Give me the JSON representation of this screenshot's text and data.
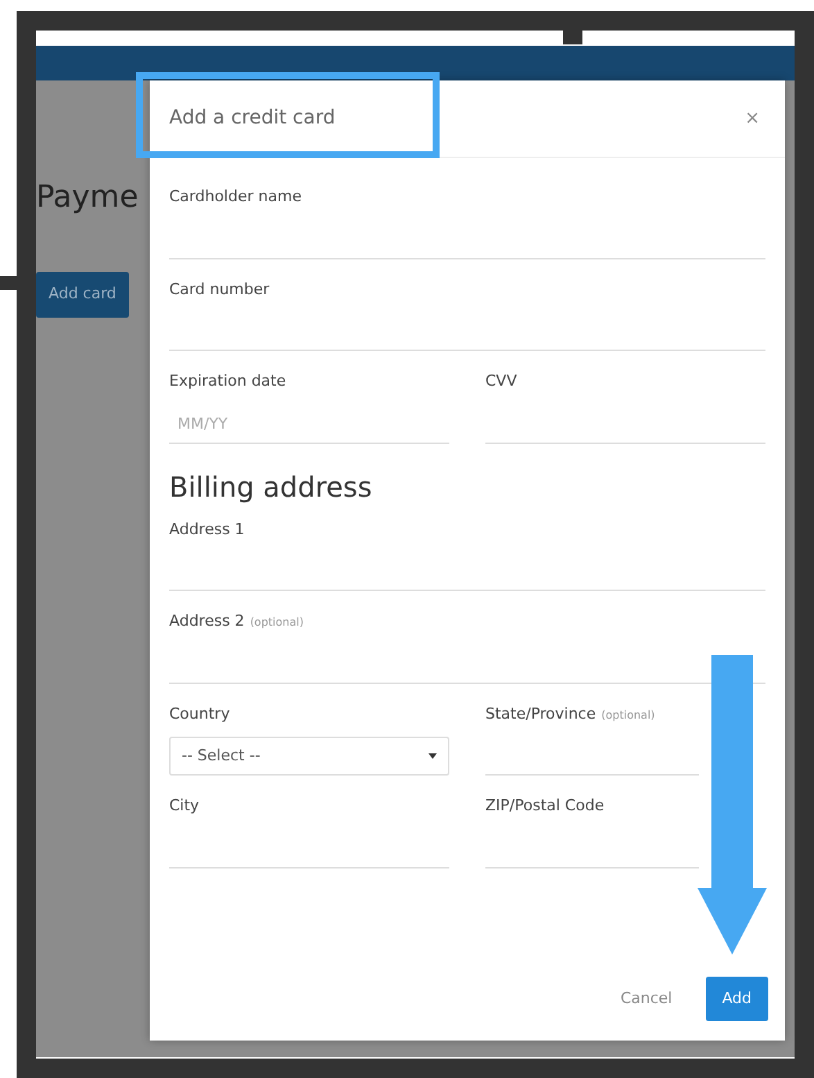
{
  "page": {
    "heading": "Payme",
    "button": "Add card"
  },
  "modal": {
    "title": "Add a credit card",
    "close": "×",
    "rows": [
      {
        "kind": "fields",
        "fields": [
          {
            "kind": "input",
            "label": "Cardholder name"
          }
        ]
      },
      {
        "kind": "fields",
        "fields": [
          {
            "kind": "input",
            "label": "Card number"
          }
        ]
      },
      {
        "kind": "fields",
        "fields": [
          {
            "kind": "input",
            "label": "Expiration date",
            "placeholder": "MM/YY"
          },
          {
            "kind": "input",
            "label": "CVV"
          }
        ]
      },
      {
        "kind": "heading",
        "text": "Billing address"
      },
      {
        "kind": "fields",
        "fields": [
          {
            "kind": "input",
            "label": "Address 1"
          }
        ]
      },
      {
        "kind": "fields",
        "fields": [
          {
            "kind": "input",
            "label": "Address 2",
            "note": "(optional)"
          }
        ]
      },
      {
        "kind": "fields",
        "fields": [
          {
            "kind": "select",
            "label": "Country",
            "value": "-- Select --"
          },
          {
            "kind": "input",
            "label": "State/Province",
            "note": "(optional)"
          }
        ]
      },
      {
        "kind": "fields",
        "fields": [
          {
            "kind": "input",
            "label": "City"
          },
          {
            "kind": "input",
            "label": "ZIP/Postal Code"
          }
        ]
      }
    ],
    "cancel": "Cancel",
    "submit": "Add"
  }
}
